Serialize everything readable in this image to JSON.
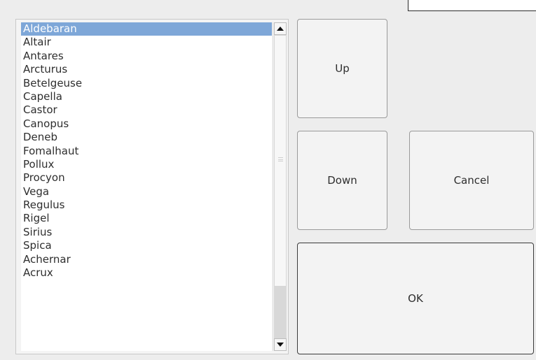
{
  "list": {
    "items": [
      "Aldebaran",
      "Altair",
      "Antares",
      "Arcturus",
      "Betelgeuse",
      "Capella",
      "Castor",
      "Canopus",
      "Deneb",
      "Fomalhaut",
      "Pollux",
      "Procyon",
      "Vega",
      "Regulus",
      "Rigel",
      "Sirius",
      "Spica",
      "Achernar",
      "Acrux"
    ],
    "selected_index": 0,
    "selection_color": "#7ea7d8"
  },
  "buttons": {
    "up_label": "Up",
    "down_label": "Down",
    "cancel_label": "Cancel",
    "ok_label": "OK"
  },
  "icons": {
    "scroll_up": "scroll-up-arrow-icon",
    "scroll_down": "scroll-down-arrow-icon",
    "thumb_grip": "scroll-grip-icon"
  }
}
